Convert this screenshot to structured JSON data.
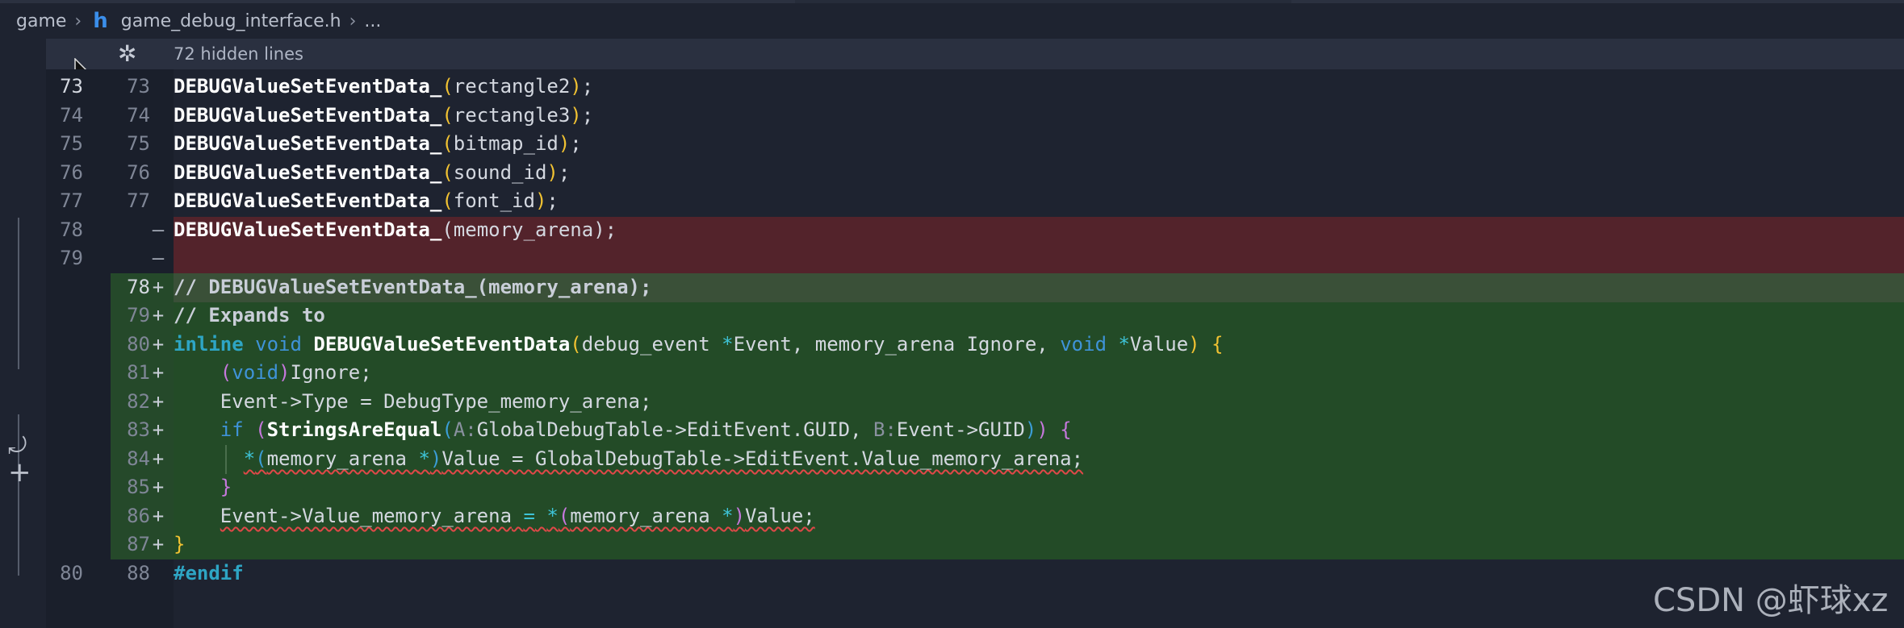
{
  "breadcrumb": {
    "root": "game",
    "file": "game_debug_interface.h",
    "tail": "...",
    "file_icon": "h"
  },
  "hidden_lines": {
    "label": "72 hidden lines",
    "icon": "unfold-icon"
  },
  "rows": [
    {
      "lnA": "73",
      "lnB": "73",
      "mark": ""
    },
    {
      "lnA": "74",
      "lnB": "74",
      "mark": ""
    },
    {
      "lnA": "75",
      "lnB": "75",
      "mark": ""
    },
    {
      "lnA": "76",
      "lnB": "76",
      "mark": ""
    },
    {
      "lnA": "77",
      "lnB": "77",
      "mark": ""
    },
    {
      "lnA": "78",
      "lnB": "",
      "mark": "—"
    },
    {
      "lnA": "79",
      "lnB": "",
      "mark": "—"
    },
    {
      "lnA": "",
      "lnB": "78",
      "mark": "+"
    },
    {
      "lnA": "",
      "lnB": "79",
      "mark": "+"
    },
    {
      "lnA": "",
      "lnB": "80",
      "mark": "+"
    },
    {
      "lnA": "",
      "lnB": "81",
      "mark": "+"
    },
    {
      "lnA": "",
      "lnB": "82",
      "mark": "+"
    },
    {
      "lnA": "",
      "lnB": "83",
      "mark": "+"
    },
    {
      "lnA": "",
      "lnB": "84",
      "mark": "+"
    },
    {
      "lnA": "",
      "lnB": "85",
      "mark": "+"
    },
    {
      "lnA": "",
      "lnB": "86",
      "mark": "+"
    },
    {
      "lnA": "",
      "lnB": "87",
      "mark": "+"
    },
    {
      "lnA": "80",
      "lnB": "88",
      "mark": ""
    }
  ],
  "code": {
    "fn": "DEBUGValueSetEventData_",
    "fn2": "DEBUGValueSetEventData",
    "l1_arg": "rectangle2",
    "l2_arg": "rectangle3",
    "l3_arg": "bitmap_id",
    "l4_arg": "sound_id",
    "l5_arg": "font_id",
    "l6_arg": "memory_arena",
    "semi": ";",
    "l8": "// DEBUGValueSetEventData_(memory_arena);",
    "l9": "// Expands to",
    "kw_inline": "inline",
    "kw_void": "void",
    "p_debug_event": "debug_event",
    "p_event": "Event,",
    "p_memory_arena": "memory_arena",
    "p_ignore": "Ignore,",
    "p_value": "Value",
    "l11_ignore": "Ignore;",
    "l12": "Event->Type = DebugType_memory_arena;",
    "kw_if": "if",
    "fn_strings": "StringsAreEqual",
    "hint_a": "A:",
    "arg_a": "GlobalDebugTable->EditEvent.GUID,",
    "hint_b": "B:",
    "arg_b": "Event->GUID",
    "l14_type": "memory_arena ",
    "l14_rest": "Value = GlobalDebugTable->EditEvent.Value_memory_arena;",
    "l16_lhs": "Event->Value_memory_arena",
    "l16_type": "memory_arena ",
    "l16_val": "Value;",
    "endif": "#endif"
  },
  "watermark": "CSDN @虾球xz",
  "colors": {
    "deleted_bg": "#53232b",
    "added_bg": "#234b27",
    "added_highlight_bg": "#3a5038",
    "editor_bg": "#1e2330",
    "squiggle": "#e04848"
  }
}
